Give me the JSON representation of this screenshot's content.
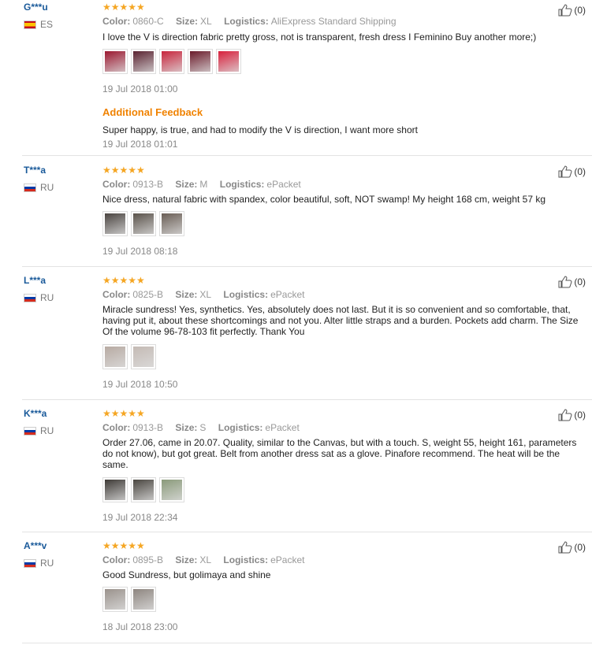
{
  "reviews": [
    {
      "user": "G***u",
      "country": "ES",
      "flag": "es",
      "stars": "★★★★★",
      "color_label": "Color:",
      "color": "0860-C",
      "size_label": "Size:",
      "size": "XL",
      "logistics_label": "Logistics:",
      "logistics": "AliExpress Standard Shipping",
      "text": "I love the V is direction fabric pretty gross, not is transparent, fresh dress I Feminino Buy another more;)",
      "thumbs": [
        "#9b1830",
        "#5a2230",
        "#c8243c",
        "#6b1a2a",
        "#d8203c"
      ],
      "date": "19 Jul 2018 01:00",
      "additional_label": "Additional Feedback",
      "additional_text": "Super happy, is true, and had to modify the V is direction, I want more short",
      "additional_date": "19 Jul 2018 01:01",
      "likes": "(0)"
    },
    {
      "user": "T***a",
      "country": "RU",
      "flag": "ru",
      "stars": "★★★★★",
      "color_label": "Color:",
      "color": "0913-B",
      "size_label": "Size:",
      "size": "M",
      "logistics_label": "Logistics:",
      "logistics": "ePacket",
      "text": "Nice dress, natural fabric with spandex, color beautiful, soft, NOT swamp! My height 168 cm, weight 57 kg",
      "thumbs": [
        "#4a4440",
        "#5a524a",
        "#6a5e55"
      ],
      "date": "19 Jul 2018 08:18",
      "likes": "(0)"
    },
    {
      "user": "L***a",
      "country": "RU",
      "flag": "ru",
      "stars": "★★★★★",
      "color_label": "Color:",
      "color": "0825-B",
      "size_label": "Size:",
      "size": "XL",
      "logistics_label": "Logistics:",
      "logistics": "ePacket",
      "text": "Miracle sundress! Yes, synthetics. Yes, absolutely does not last. But it is so convenient and so comfortable, that, having put it, about these shortcomings and not you. Alter little straps and a burden. Pockets add charm. The Size Of the volume 96-78-103 fit perfectly. Thank You",
      "thumbs": [
        "#b7aaa2",
        "#c4bab4"
      ],
      "date": "19 Jul 2018 10:50",
      "likes": "(0)"
    },
    {
      "user": "K***a",
      "country": "RU",
      "flag": "ru",
      "stars": "★★★★★",
      "color_label": "Color:",
      "color": "0913-B",
      "size_label": "Size:",
      "size": "S",
      "logistics_label": "Logistics:",
      "logistics": "ePacket",
      "text": "Order 27.06, came in 20.07. Quality, similar to the Canvas, but with a touch. S, weight 55, height 161, parameters do not know), but got great. Belt from another dress sat as a glove. Pinafore recommend. The heat will be the same.",
      "thumbs": [
        "#3e3a36",
        "#4a4640",
        "#8a9a7a"
      ],
      "date": "19 Jul 2018 22:34",
      "likes": "(0)"
    },
    {
      "user": "A***v",
      "country": "RU",
      "flag": "ru",
      "stars": "★★★★★",
      "color_label": "Color:",
      "color": "0895-B",
      "size_label": "Size:",
      "size": "XL",
      "logistics_label": "Logistics:",
      "logistics": "ePacket",
      "text": "Good Sundress, but golimaya and shine",
      "thumbs": [
        "#9a928c",
        "#8e8680"
      ],
      "date": "18 Jul 2018 23:00",
      "likes": "(0)"
    }
  ]
}
